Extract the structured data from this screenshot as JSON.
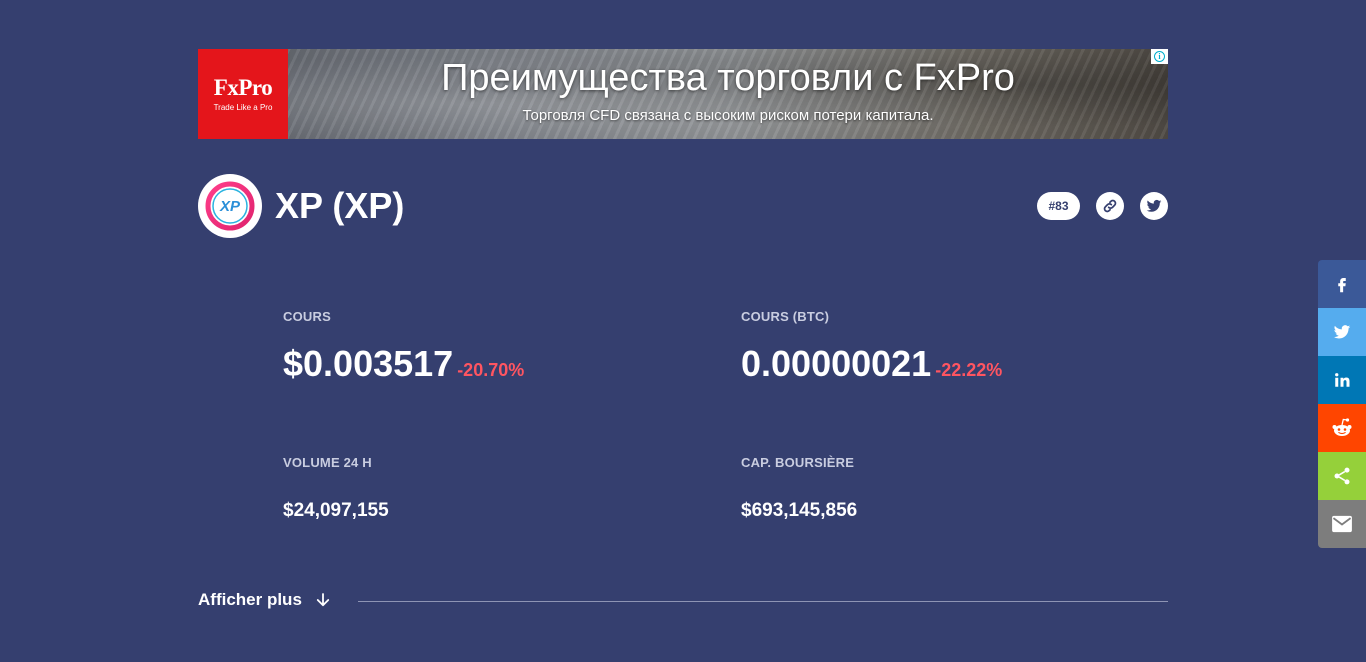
{
  "ad": {
    "logo_name": "FxPro",
    "logo_tagline": "Trade Like a Pro",
    "headline": "Преимущества торговли с FxPro",
    "subtext": "Торговля CFD связана с высоким риском потери капитала.",
    "info_icon": "i"
  },
  "coin": {
    "logo_text": "XP",
    "title": "XP (XP)",
    "rank": "#83"
  },
  "stats": {
    "price_label": "COURS",
    "price_value": "$0.003517",
    "price_change": "-20.70%",
    "btc_label": "COURS (BTC)",
    "btc_value": "0.00000021",
    "btc_change": "-22.22%",
    "volume_label": "VOLUME 24 H",
    "volume_value": "$24,097,155",
    "marketcap_label": "CAP. BOURSIÈRE",
    "marketcap_value": "$693,145,856"
  },
  "show_more": {
    "label": "Afficher plus"
  },
  "share": [
    "facebook-icon",
    "twitter-icon",
    "linkedin-icon",
    "reddit-icon",
    "share-icon",
    "email-icon"
  ],
  "colors": {
    "background": "#353f6f",
    "negative": "#ff5561",
    "facebook": "#3b5998",
    "twitter": "#55acee",
    "linkedin": "#0077b5",
    "reddit": "#ff4500",
    "share": "#95d03a",
    "email": "#7d7d7d"
  }
}
